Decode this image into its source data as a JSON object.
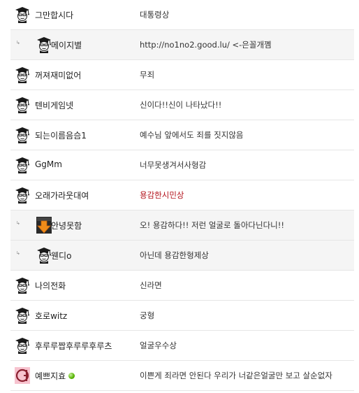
{
  "reply_label": "RE",
  "rows": [
    {
      "nick": "그만합시다",
      "comment": "대통령상",
      "reply": false,
      "avatar": "graduate-icon",
      "online": false,
      "highlight": false
    },
    {
      "nick": "메이지별",
      "comment": "http://no1no2.good.lu/ <-은꼴개꼠",
      "reply": true,
      "avatar": "graduate-icon",
      "online": false,
      "highlight": false
    },
    {
      "nick": "꺼져재미없어",
      "comment": "무죄",
      "reply": false,
      "avatar": "graduate-icon",
      "online": false,
      "highlight": false
    },
    {
      "nick": "텐비게임넷",
      "comment": "신이다!!신이 나타났다!!",
      "reply": false,
      "avatar": "graduate-icon",
      "online": false,
      "highlight": false
    },
    {
      "nick": "되는이름음슴1",
      "comment": "예수님 앞에서도 죄를 짓지않음",
      "reply": false,
      "avatar": "graduate-icon",
      "online": false,
      "highlight": false
    },
    {
      "nick": "GgMm",
      "comment": "너무못생겨서사형감",
      "reply": false,
      "avatar": "graduate-icon",
      "online": false,
      "highlight": false
    },
    {
      "nick": "오래가라웃대여",
      "comment": "용감한시민상",
      "reply": false,
      "avatar": "graduate-icon",
      "online": false,
      "highlight": true
    },
    {
      "nick": "안녕못함",
      "comment": "오! 용감하다!! 저런 얼굴로 돌아다닌다니!!",
      "reply": true,
      "avatar": "arrow-avatar-icon",
      "online": false,
      "highlight": false
    },
    {
      "nick": "웬디o",
      "comment": "아닌데 용감한형제상",
      "reply": true,
      "avatar": "graduate-icon",
      "online": false,
      "highlight": false
    },
    {
      "nick": "나의전화",
      "comment": "신라면",
      "reply": false,
      "avatar": "graduate-icon",
      "online": false,
      "highlight": false
    },
    {
      "nick": "호로witz",
      "comment": "궁형",
      "reply": false,
      "avatar": "graduate-icon",
      "online": false,
      "highlight": false
    },
    {
      "nick": "후루루짭후루루후루츠",
      "comment": "얼굴우수상",
      "reply": false,
      "avatar": "graduate-icon",
      "online": false,
      "highlight": false
    },
    {
      "nick": "예쁘지효",
      "comment": "이쁜게 죄라면 안된다 우리가 너같은얼굴만 보고 살순없자",
      "reply": false,
      "avatar": "pink-char-avatar-icon",
      "online": true,
      "highlight": false
    }
  ],
  "colors": {
    "highlight": "#b3121b",
    "reply_bg": "#f5f5f5",
    "divider": "#e6e6e6",
    "online": "#55b300"
  }
}
